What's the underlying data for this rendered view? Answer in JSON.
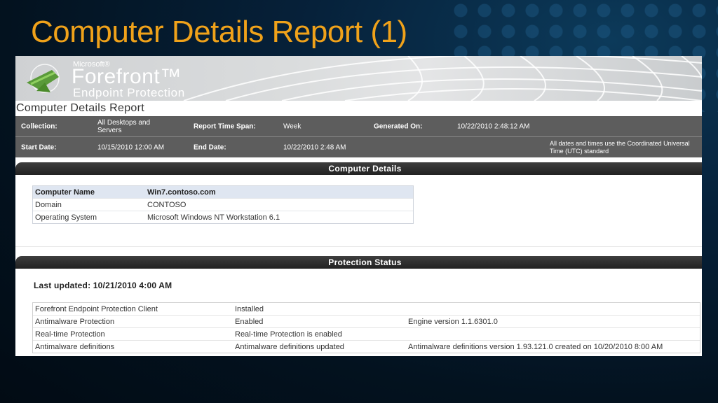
{
  "slide": {
    "title": "Computer Details Report (1)"
  },
  "brand": {
    "microsoft": "Microsoft®",
    "forefront": "Forefront™",
    "endpoint": "Endpoint Protection"
  },
  "report": {
    "title": "Computer Details Report",
    "params": {
      "collection_label": "Collection:",
      "collection_value": "All Desktops and Servers",
      "timespan_label": "Report Time Span:",
      "timespan_value": "Week",
      "generated_label": "Generated On:",
      "generated_value": "10/22/2010 2:48:12 AM",
      "start_label": "Start Date:",
      "start_value": "10/15/2010 12:00 AM",
      "end_label": "End Date:",
      "end_value": "10/22/2010 2:48 AM",
      "utc_note": "All dates and times use the Coordinated Universal Time (UTC) standard"
    }
  },
  "computer_details": {
    "heading": "Computer Details",
    "rows": [
      {
        "label": "Computer Name",
        "value": "Win7.contoso.com"
      },
      {
        "label": "Domain",
        "value": "CONTOSO"
      },
      {
        "label": "Operating System",
        "value": "Microsoft Windows NT Workstation 6.1"
      }
    ]
  },
  "protection_status": {
    "heading": "Protection Status",
    "last_updated": "Last updated: 10/21/2010 4:00 AM",
    "rows": [
      {
        "item": "Forefront Endpoint Protection Client",
        "status": "Installed",
        "detail": ""
      },
      {
        "item": "Antimalware Protection",
        "status": "Enabled",
        "detail": "Engine version 1.1.6301.0"
      },
      {
        "item": "Real-time Protection",
        "status": "Real-time Protection is enabled",
        "detail": ""
      },
      {
        "item": "Antimalware definitions",
        "status": "Antimalware definitions updated",
        "detail": "Antimalware definitions version 1.93.121.0 created on 10/20/2010 8:00 AM"
      }
    ]
  },
  "colors": {
    "title": "#f0a21a",
    "background": "#03121f",
    "param_bar": "#5d5d5d",
    "section_bar": "#2a2a2a"
  }
}
